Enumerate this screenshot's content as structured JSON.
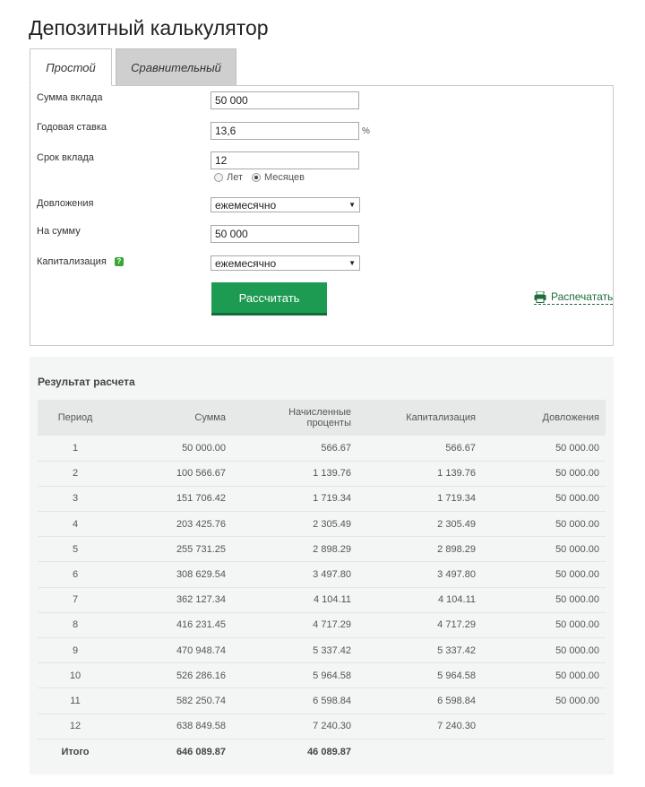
{
  "title": "Депозитный калькулятор",
  "tabs": [
    {
      "label": "Простой",
      "active": true
    },
    {
      "label": "Сравнительный",
      "active": false
    }
  ],
  "form": {
    "amount": {
      "label": "Сумма вклада",
      "value": "50 000"
    },
    "rate": {
      "label": "Годовая ставка",
      "value": "13,6",
      "unit": "%"
    },
    "term": {
      "label": "Срок вклада",
      "value": "12",
      "options": [
        {
          "label": "Лет",
          "checked": false
        },
        {
          "label": "Месяцев",
          "checked": true
        }
      ]
    },
    "additions": {
      "label": "Довложения",
      "value": "ежемесячно"
    },
    "addition_amount": {
      "label": "На сумму",
      "value": "50 000"
    },
    "capitalization": {
      "label": "Капитализация",
      "value": "ежемесячно",
      "help_icon_text": "?"
    },
    "calculate_label": "Рассчитать",
    "print_label": "Распечатать"
  },
  "results": {
    "title": "Результат расчета",
    "columns": [
      "Период",
      "Сумма",
      "Начисленные проценты",
      "Капитализация",
      "Довложения"
    ],
    "rows": [
      [
        "1",
        "50 000.00",
        "566.67",
        "566.67",
        "50 000.00"
      ],
      [
        "2",
        "100 566.67",
        "1 139.76",
        "1 139.76",
        "50 000.00"
      ],
      [
        "3",
        "151 706.42",
        "1 719.34",
        "1 719.34",
        "50 000.00"
      ],
      [
        "4",
        "203 425.76",
        "2 305.49",
        "2 305.49",
        "50 000.00"
      ],
      [
        "5",
        "255 731.25",
        "2 898.29",
        "2 898.29",
        "50 000.00"
      ],
      [
        "6",
        "308 629.54",
        "3 497.80",
        "3 497.80",
        "50 000.00"
      ],
      [
        "7",
        "362 127.34",
        "4 104.11",
        "4 104.11",
        "50 000.00"
      ],
      [
        "8",
        "416 231.45",
        "4 717.29",
        "4 717.29",
        "50 000.00"
      ],
      [
        "9",
        "470 948.74",
        "5 337.42",
        "5 337.42",
        "50 000.00"
      ],
      [
        "10",
        "526 286.16",
        "5 964.58",
        "5 964.58",
        "50 000.00"
      ],
      [
        "11",
        "582 250.74",
        "6 598.84",
        "6 598.84",
        "50 000.00"
      ],
      [
        "12",
        "638 849.58",
        "7 240.30",
        "7 240.30",
        ""
      ]
    ],
    "total": {
      "label": "Итого",
      "sum": "646 089.87",
      "interest": "46 089.87"
    }
  },
  "colors": {
    "accent": "#1e9b52",
    "link": "#1e6e3a",
    "help": "#3aa635"
  }
}
